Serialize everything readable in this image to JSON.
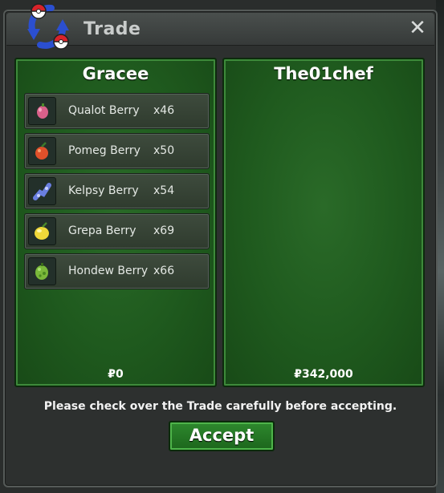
{
  "window": {
    "title": "Trade",
    "close_label": "✕"
  },
  "left_panel": {
    "name": "Gracee",
    "money": "₽0",
    "items": [
      {
        "name": "Qualot Berry",
        "qty": "x46",
        "icon": "qualot-berry-icon",
        "color": "#d9608a"
      },
      {
        "name": "Pomeg Berry",
        "qty": "x50",
        "icon": "pomeg-berry-icon",
        "color": "#e0502a"
      },
      {
        "name": "Kelpsy Berry",
        "qty": "x54",
        "icon": "kelpsy-berry-icon",
        "color": "#6a7fe0"
      },
      {
        "name": "Grepa Berry",
        "qty": "x69",
        "icon": "grepa-berry-icon",
        "color": "#f0d83a"
      },
      {
        "name": "Hondew Berry",
        "qty": "x66",
        "icon": "hondew-berry-icon",
        "color": "#7ab83a"
      }
    ]
  },
  "right_panel": {
    "name": "The01chef",
    "money": "₽342,000",
    "items": []
  },
  "footer": {
    "message": "Please check over the Trade carefully before accepting.",
    "accept_label": "Accept"
  },
  "colors": {
    "panel_green": "#1f5a1e",
    "accept_green": "#2e8a2e"
  }
}
